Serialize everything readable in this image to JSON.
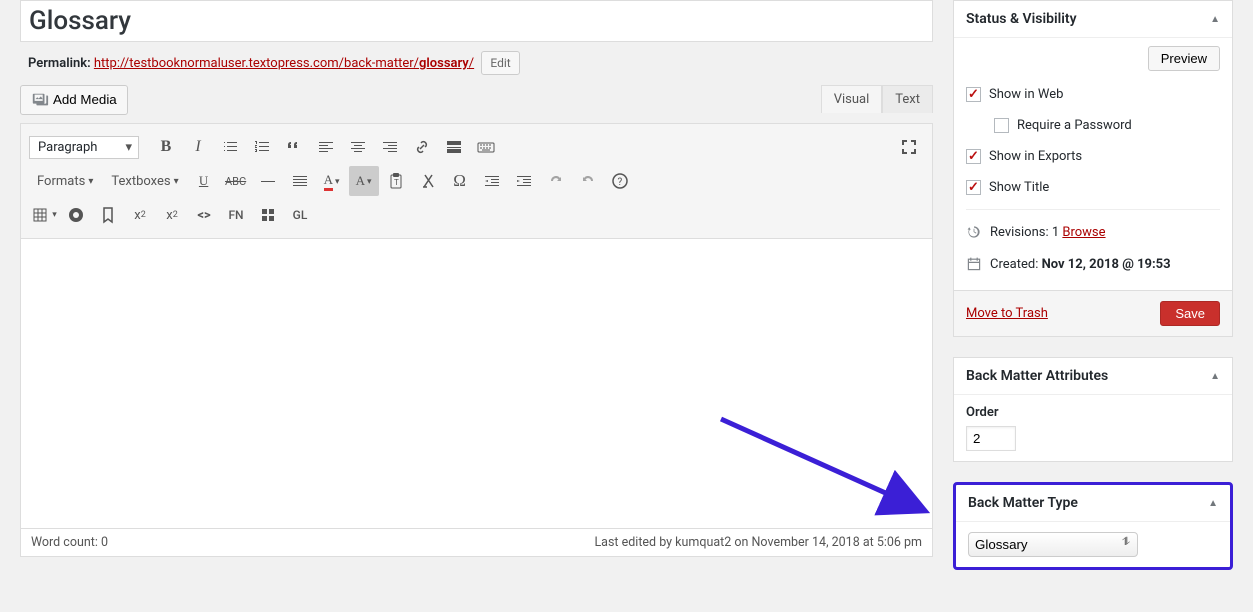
{
  "title": "Glossary",
  "permalink": {
    "label": "Permalink:",
    "base": "http://testbooknormaluser.textopress.com/back-matter/",
    "slug": "glossary",
    "suffix": "/",
    "edit": "Edit"
  },
  "mediaBtn": "Add Media",
  "tabs": {
    "visual": "Visual",
    "text": "Text"
  },
  "toolbar": {
    "paragraph": "Paragraph",
    "formats": "Formats",
    "textboxes": "Textboxes",
    "fn": "FN",
    "gl": "GL"
  },
  "footer": {
    "wordcountLabel": "Word count: ",
    "wordcount": "0",
    "lastEdited": "Last edited by kumquat2 on November 14, 2018 at 5:06 pm"
  },
  "statusPanel": {
    "title": "Status & Visibility",
    "preview": "Preview",
    "showWeb": "Show in Web",
    "reqPass": "Require a Password",
    "showExports": "Show in Exports",
    "showTitle": "Show Title",
    "revisionsLabel": "Revisions: ",
    "revisionsCount": "1",
    "browse": "Browse",
    "createdLabel": "Created: ",
    "createdDate": "Nov 12, 2018 @ 19:53",
    "trash": "Move to Trash",
    "save": "Save"
  },
  "attrPanel": {
    "title": "Back Matter Attributes",
    "orderLabel": "Order",
    "orderValue": "2"
  },
  "typePanel": {
    "title": "Back Matter Type",
    "selected": "Glossary"
  }
}
